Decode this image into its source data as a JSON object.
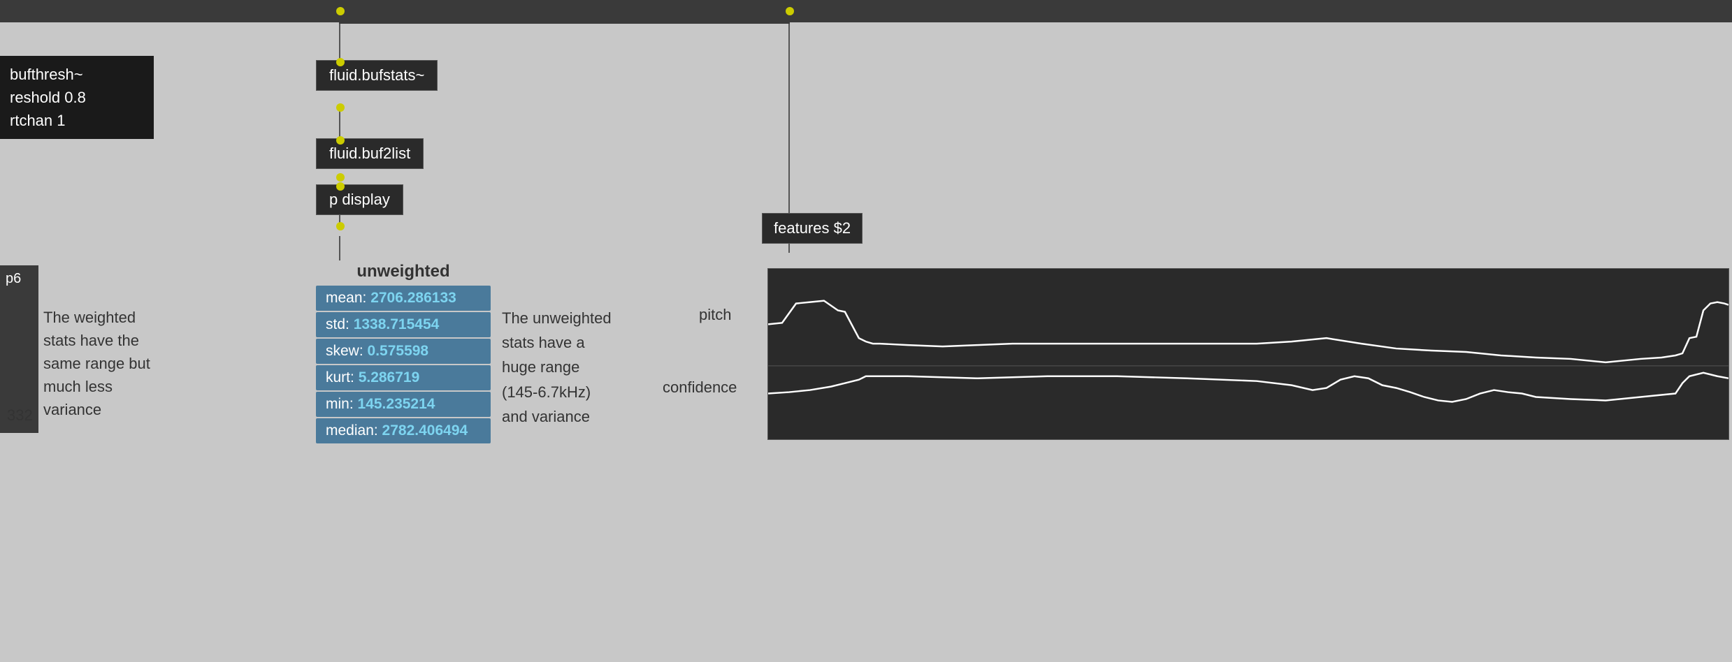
{
  "topBar": {},
  "leftPanel": {
    "line1": "bufthresh~",
    "line2": "reshold 0.8",
    "line3": "rtchan 1"
  },
  "leftBottomPanel": {
    "label": "p6"
  },
  "weightedText": {
    "line1": "The weighted",
    "line2": "stats have the",
    "line3": "same range but",
    "line4": "much less",
    "line5": "variance"
  },
  "numberLabel": "332",
  "nodes": {
    "bufstats": "fluid.bufstats~",
    "buf2list": "fluid.buf2list",
    "pdisplay": "p display"
  },
  "statsPanel": {
    "title": "unweighted",
    "rows": [
      {
        "label": "mean:",
        "value": "2706.286133"
      },
      {
        "label": "std:",
        "value": "1338.715454"
      },
      {
        "label": "skew:",
        "value": "0.575598"
      },
      {
        "label": "kurt:",
        "value": "5.286719"
      },
      {
        "label": "min:",
        "value": "145.235214"
      },
      {
        "label": "median:",
        "value": "2782.406494"
      }
    ]
  },
  "unweightedText": {
    "line1": "The unweighted",
    "line2": "stats have a",
    "line3": "huge range",
    "line4": "(145-6.7kHz)",
    "line5": "and variance"
  },
  "featuresLabel": "features $2",
  "pitchLabel": "pitch",
  "confidenceLabel": "confidence"
}
